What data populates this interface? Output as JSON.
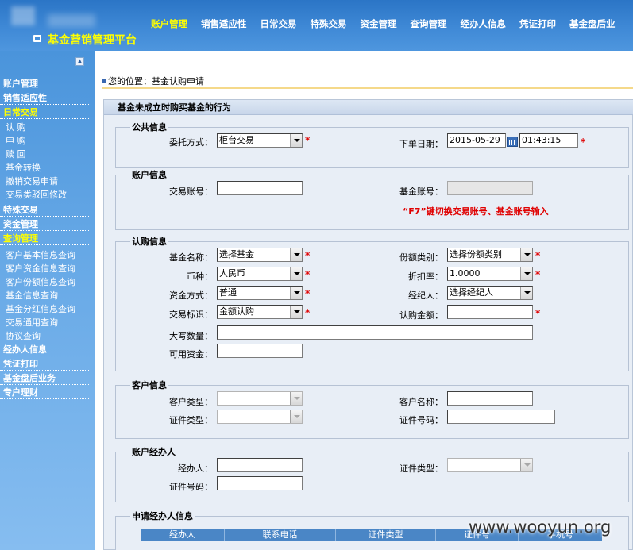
{
  "app": {
    "title": "基金营销管理平台"
  },
  "topnav": [
    {
      "label": "账户管理",
      "active": true
    },
    {
      "label": "销售适应性",
      "active": false
    },
    {
      "label": "日常交易",
      "active": false
    },
    {
      "label": "特殊交易",
      "active": false
    },
    {
      "label": "资金管理",
      "active": false
    },
    {
      "label": "查询管理",
      "active": false
    },
    {
      "label": "经办人信息",
      "active": false
    },
    {
      "label": "凭证打印",
      "active": false
    },
    {
      "label": "基金盘后业",
      "active": false
    }
  ],
  "sidebar": {
    "collapse_glyph": "▲",
    "groups": [
      {
        "label": "账户管理",
        "active": false
      },
      {
        "label": "销售适应性",
        "active": false
      },
      {
        "label": "日常交易",
        "active": true
      },
      {
        "label": "特殊交易",
        "active": false
      },
      {
        "label": "资金管理",
        "active": false
      },
      {
        "label": "查询管理",
        "active": true
      },
      {
        "label": "经办人信息",
        "active": false
      },
      {
        "label": "凭证打印",
        "active": false
      },
      {
        "label": "基金盘后业务",
        "active": false
      },
      {
        "label": "专户理财",
        "active": false
      }
    ],
    "trade_items": [
      "认 购",
      "申 购",
      "赎 回",
      "基金转换",
      "撤销交易申请",
      "交易类驳回修改"
    ],
    "query_items": [
      "客户基本信息查询",
      "客户资金信息查询",
      "客户份额信息查询",
      "基金信息查询",
      "基金分红信息查询",
      "交易通用查询",
      "协议查询"
    ]
  },
  "breadcrumb": "您的位置：基金认购申请",
  "panel": {
    "title": "基金未成立时购买基金的行为"
  },
  "public_info": {
    "legend": "公共信息",
    "delegate_label": "委托方式：",
    "delegate_value": "柜台交易",
    "date_label": "下单日期：",
    "date_value": "2015-05-29",
    "time_value": "01:43:15"
  },
  "account_info": {
    "legend": "账户信息",
    "trade_acct_label": "交易账号：",
    "trade_acct_value": "",
    "fund_acct_label": "基金账号：",
    "fund_acct_value": "",
    "hint": "“F7”键切换交易账号、基金账号输入"
  },
  "subscribe_info": {
    "legend": "认购信息",
    "fund_name_label": "基金名称：",
    "fund_name_value": "选择基金",
    "share_type_label": "份额类别：",
    "share_type_value": "选择份额类别",
    "currency_label": "币种：",
    "currency_value": "人民币",
    "discount_label": "折扣率：",
    "discount_value": "1.0000",
    "fund_method_label": "资金方式：",
    "fund_method_value": "普通",
    "broker_label": "经纪人：",
    "broker_value": "选择经纪人",
    "trade_flag_label": "交易标识：",
    "trade_flag_value": "金额认购",
    "amount_label": "认购金额：",
    "amount_value": "",
    "capital_amount_label": "大写数量：",
    "capital_amount_value": "",
    "available_funds_label": "可用资金：",
    "available_funds_value": ""
  },
  "customer_info": {
    "legend": "客户信息",
    "cust_type_label": "客户类型：",
    "cust_name_label": "客户名称：",
    "id_type_label": "证件类型：",
    "id_no_label": "证件号码："
  },
  "account_agent": {
    "legend": "账户经办人",
    "agent_label": "经办人：",
    "id_type_label": "证件类型：",
    "id_no_label": "证件号码："
  },
  "apply_agent": {
    "legend": "申请经办人信息",
    "columns": [
      "经办人",
      "联系电话",
      "证件类型",
      "证件号",
      "手机号"
    ]
  },
  "watermark": "www.wooyun.org",
  "required_mark": "*"
}
